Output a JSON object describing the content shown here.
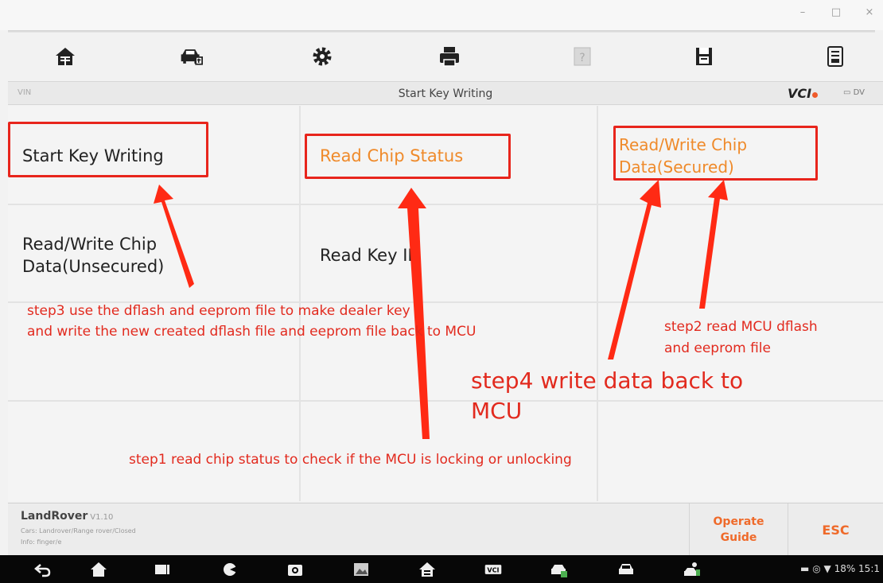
{
  "window": {
    "min": "–",
    "max": "□",
    "close": "×"
  },
  "toolbar": {
    "small_tab": "",
    "icons": [
      "home-icon",
      "car-icon",
      "gear-icon",
      "print-icon",
      "help-icon",
      "save-icon",
      "report-icon"
    ]
  },
  "titlebar": {
    "vin": "VIN",
    "title": "Start Key Writing",
    "vci": "VCI",
    "dv": "DV"
  },
  "grid": {
    "cells": [
      {
        "label": "Start Key Writing",
        "color": "#222222"
      },
      {
        "label": "Read Chip Status",
        "color": "#ef8a2a"
      },
      {
        "label_line1": "Read/Write Chip",
        "label_line2": "Data(Secured)",
        "color": "#ef8a2a"
      },
      {
        "label_line1": "Read/Write Chip",
        "label_line2": "Data(Unsecured)",
        "color": "#222222"
      },
      {
        "label": "Read Key ID",
        "color": "#222222"
      }
    ]
  },
  "annotations": {
    "step3_line1": "step3 use the dflash and eeprom file to make dealer key",
    "step3_line2": "and write the new created dflash file and eeprom file back to MCU",
    "step2_line1": "step2 read MCU dflash",
    "step2_line2": "and eeprom file",
    "step4_line1": "step4 write data back to",
    "step4_line2": "MCU",
    "step1": "step1 read chip status to check if the MCU is locking or unlocking",
    "color": "#e22a1e"
  },
  "footer": {
    "brand": "LandRover",
    "version": "V1.10",
    "line1": "Cars: Landrover/Range rover/Closed",
    "line2": "Info: finger/e",
    "operate_guide_line1": "Operate",
    "operate_guide_line2": "Guide",
    "esc": "ESC"
  },
  "navbar": {
    "icons": [
      "back-icon",
      "home-icon",
      "recent-apps-icon",
      "browser-icon",
      "camera-icon",
      "gallery-icon",
      "home-app-icon",
      "vci-icon",
      "car-diag-icon",
      "car-icon",
      "person-car-icon"
    ],
    "status": "18% 15:1"
  }
}
